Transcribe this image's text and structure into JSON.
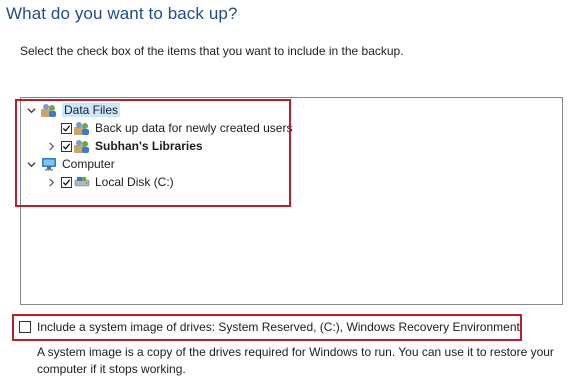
{
  "heading": "What do you want to back up?",
  "instruction": "Select the check box of the items that you want to include in the backup.",
  "tree": {
    "data_files": {
      "label": "Data Files",
      "expanded": true,
      "icon": "user-group-icon"
    },
    "backup_new_users": {
      "label": "Back up data for newly created users",
      "checked": true,
      "icon": "user-group-icon"
    },
    "libraries": {
      "label": "Subhan's Libraries",
      "checked": true,
      "icon": "user-group-icon"
    },
    "computer": {
      "label": "Computer",
      "expanded": true,
      "icon": "computer-icon"
    },
    "local_disk": {
      "label": "Local Disk (C:)",
      "checked": true,
      "icon": "drive-icon"
    }
  },
  "system_image": {
    "label": "Include a system image of drives: System Reserved, (C:), Windows Recovery Environment",
    "checked": false,
    "description": "A system image is a copy of the drives required for Windows to run. You can use it to restore your computer if it stops working."
  },
  "colors": {
    "heading": "#1f4e8c",
    "highlight_border": "#b9202a",
    "selection": "#cce8ff"
  }
}
